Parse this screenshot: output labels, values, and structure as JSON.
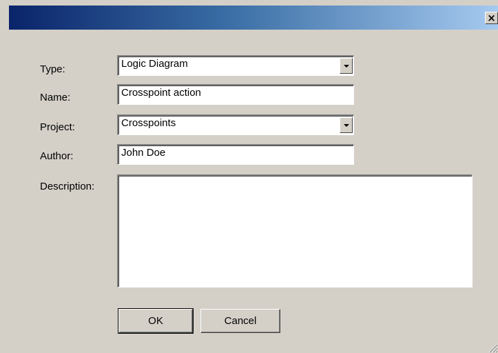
{
  "titlebar": {
    "close_glyph": "×",
    "close_icon": "close-icon"
  },
  "form": {
    "type_label": "Type:",
    "type_value": "Logic Diagram",
    "name_label": "Name:",
    "name_value": "Crosspoint action",
    "project_label": "Project:",
    "project_value": "Crosspoints",
    "author_label": "Author:",
    "author_value": "John Doe",
    "description_label": "Description:",
    "description_value": ""
  },
  "buttons": {
    "ok": "OK",
    "cancel": "Cancel"
  },
  "colors": {
    "face": "#d4d0c8",
    "title_start": "#0a246a",
    "title_end": "#a6caf0"
  }
}
